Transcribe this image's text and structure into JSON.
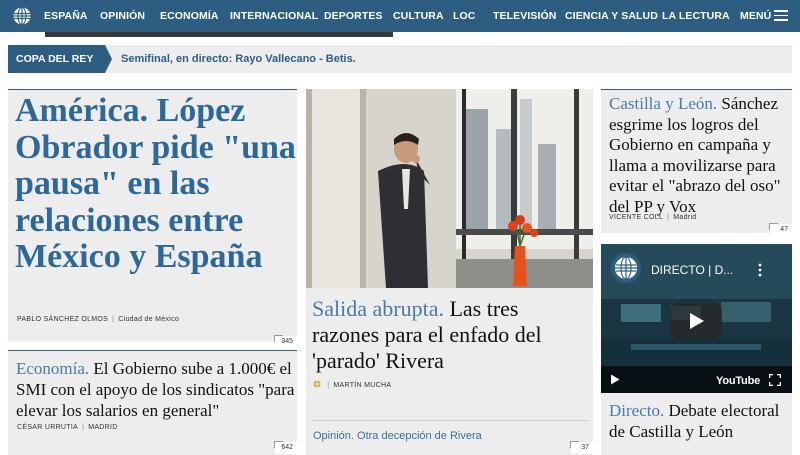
{
  "nav": {
    "items": [
      "ESPAÑA",
      "OPINIÓN",
      "ECONOMÍA",
      "INTERNACIONAL",
      "DEPORTES",
      "CULTURA",
      "LOC",
      "TELEVISIÓN",
      "CIENCIA Y SALUD",
      "LA LECTURA"
    ],
    "menu_label": "MENÚ",
    "logo_icon": "globe-logo-icon",
    "menu_icon": "hamburger-icon"
  },
  "breaking": {
    "tag": "COPA DEL REY",
    "story": "Semifinal, en directo: Rayo Vallecano - Betis."
  },
  "lead": {
    "headline": "América. López Obrador pide \"una pausa\" en las relaciones entre México y España",
    "author": "PABLO SÁNCHEZ OLMOS",
    "location": "Ciudad de México",
    "comments": "345"
  },
  "second": {
    "kicker": "Economía.",
    "headline": "El Gobierno sube a 1.000€ el SMI con el apoyo de los sindicatos \"para elevar los salarios en general\"",
    "author": "CÉSAR URRUTIA",
    "location": "MADRID",
    "comments": "642"
  },
  "center": {
    "kicker": "Salida abrupta.",
    "headline": "Las tres razones para el enfado del 'parado' Rivera",
    "author": "MARTÍN MUCHA",
    "link": "Opinión. Otra decepción de Rivera",
    "comments": "37"
  },
  "right": {
    "kicker": "Castilla y León.",
    "headline": "Sánchez esgrime los logros del Gobierno en campaña y llama a movilizarse para evitar el \"abrazo del oso\" del PP y Vox",
    "author": "VICENTE COLL",
    "location": "Madrid",
    "comments": "47"
  },
  "video": {
    "title": "DIRECTO | D...",
    "brand": "YouTube"
  },
  "direct": {
    "kicker": "Directo.",
    "headline": "Debate electoral de Castilla y León"
  },
  "colors": {
    "brand": "#2e5d82",
    "kicker": "#4a7ba8",
    "panel": "#ededed"
  }
}
